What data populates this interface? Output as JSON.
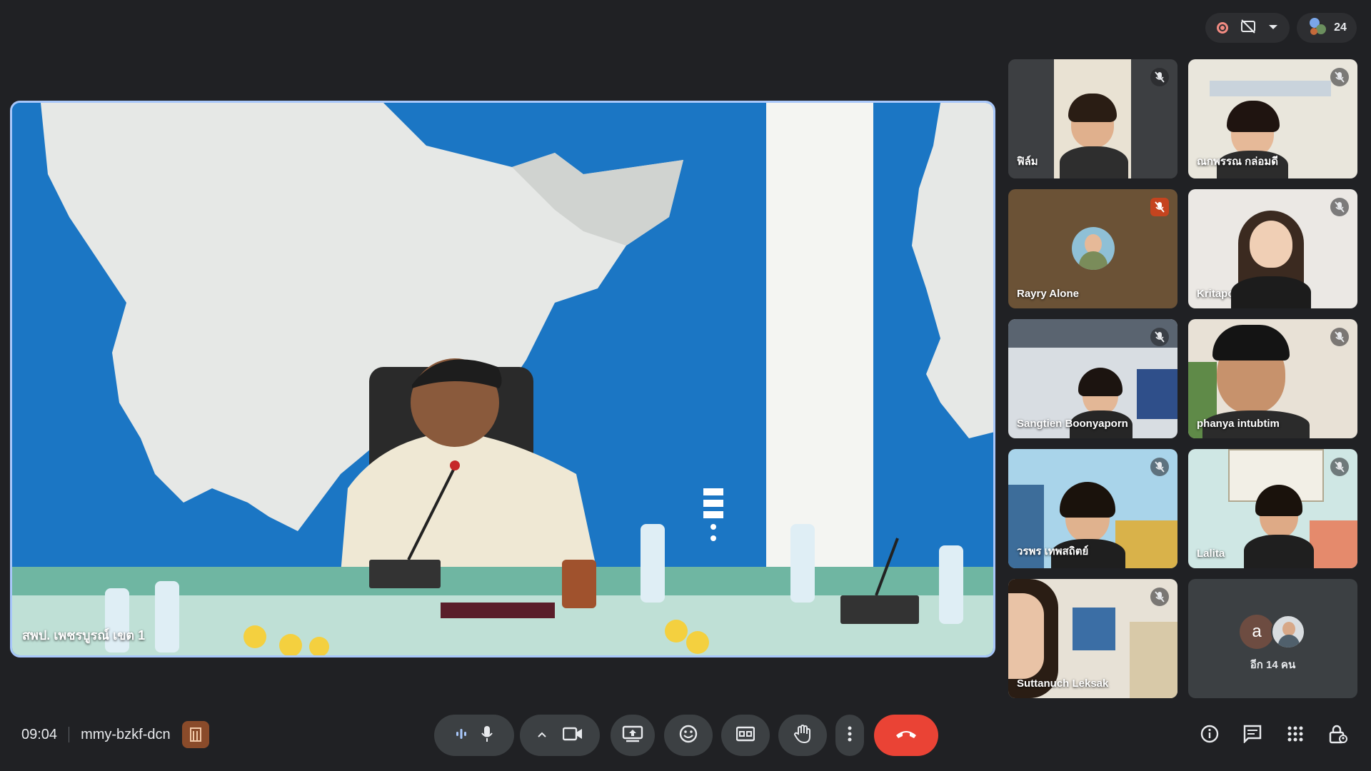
{
  "meeting": {
    "time": "09:04",
    "code": "mmy-bzkf-dcn",
    "participant_count": "24"
  },
  "main_speaker": {
    "name": "สพป. เพชรบูรณ์ เขต 1"
  },
  "tiles": [
    {
      "name": "ฟิล์ม",
      "muted": true
    },
    {
      "name": "ณกพรรณ กล่อมดี",
      "muted": true
    },
    {
      "name": "Rayry Alone",
      "muted": true,
      "mic_warning": true
    },
    {
      "name": "Kritaporn Lungka",
      "muted": true
    },
    {
      "name": "Sangtien Boonyaporn",
      "muted": true
    },
    {
      "name": "phanya intubtim",
      "muted": true
    },
    {
      "name": "วรพร เทพสถิตย์",
      "muted": true
    },
    {
      "name": "Lalita",
      "muted": true
    },
    {
      "name": "Suttanuch Leksak",
      "muted": true
    }
  ],
  "others": {
    "avatar_letter": "a",
    "label": "อีก 14 คน"
  },
  "colors": {
    "background": "#202124",
    "end_call": "#ea4335",
    "active_speaker_border": "#a8c7fa"
  }
}
